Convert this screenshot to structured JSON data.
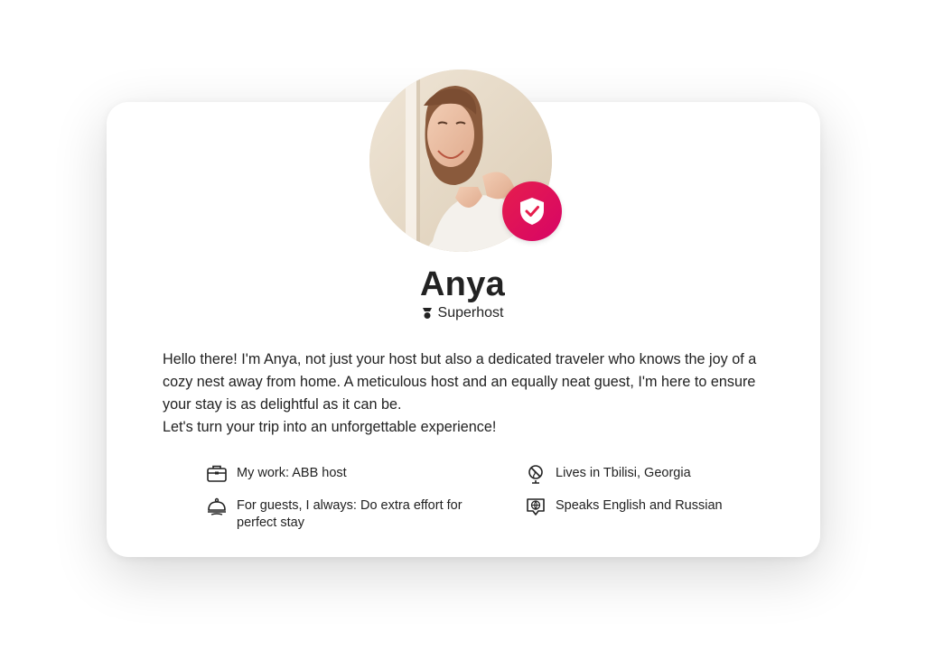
{
  "profile": {
    "name": "Anya",
    "badge_label": "Superhost",
    "bio": [
      "Hello there! I'm Anya, not just your host but also a dedicated traveler who knows the joy of a cozy nest away from home. A meticulous host and an equally neat guest, I'm here to ensure your stay is as delightful as it can be.",
      "Let's turn your trip into an unforgettable experience!"
    ]
  },
  "facts": {
    "work": {
      "icon": "briefcase-icon",
      "text": "My work: ABB host"
    },
    "lives": {
      "icon": "globe-icon",
      "text": "Lives in Tbilisi, Georgia"
    },
    "guests": {
      "icon": "cloche-icon",
      "text": "For guests, I always: Do extra effort for perfect stay"
    },
    "speaks": {
      "icon": "speech-globe-icon",
      "text": "Speaks English and Russian"
    }
  },
  "colors": {
    "accent": "#e61e4d",
    "text": "#222222"
  }
}
